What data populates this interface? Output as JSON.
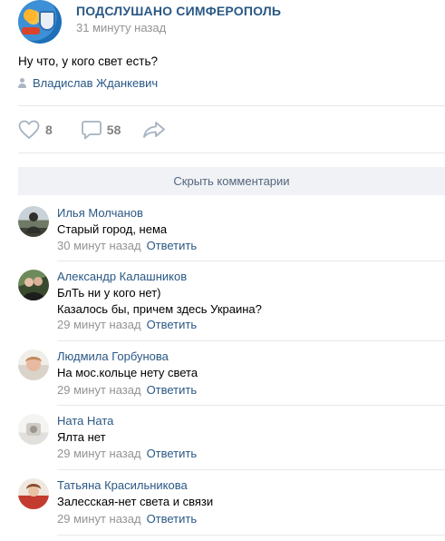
{
  "post": {
    "group_name": "ПОДСЛУШАНО СИМФЕРОПОЛЬ",
    "time": "31 минуту назад",
    "text": "Ну что, у кого свет есть?",
    "signer": "Владислав Жданкевич"
  },
  "actions": {
    "likes": "8",
    "comments": "58",
    "like_icon": "heart-icon",
    "comment_icon": "speech-bubble-icon",
    "share_icon": "share-arrow-icon"
  },
  "toggle_comments_label": "Скрыть комментарии",
  "reply_label": "Ответить",
  "comments": [
    {
      "author": "Илья Молчанов",
      "lines": [
        "Старый город, нема"
      ],
      "time": "30 минут назад"
    },
    {
      "author": "Александр Калашников",
      "lines": [
        "БлТь ни у кого нет)",
        "Казалось бы, причем здесь Украина?"
      ],
      "time": "29 минут назад"
    },
    {
      "author": "Людмила Горбунова",
      "lines": [
        "На мос.кольце нету света"
      ],
      "time": "29 минут назад"
    },
    {
      "author": "Ната Ната",
      "lines": [
        "Ялта нет"
      ],
      "time": "29 минут назад"
    },
    {
      "author": "Татьяна Красильникова",
      "lines": [
        "Залесская-нет света и связи"
      ],
      "time": "29 минут назад"
    }
  ],
  "colors": {
    "link": "#2a5885",
    "muted": "#939393",
    "button_bg": "#f0f2f5"
  }
}
